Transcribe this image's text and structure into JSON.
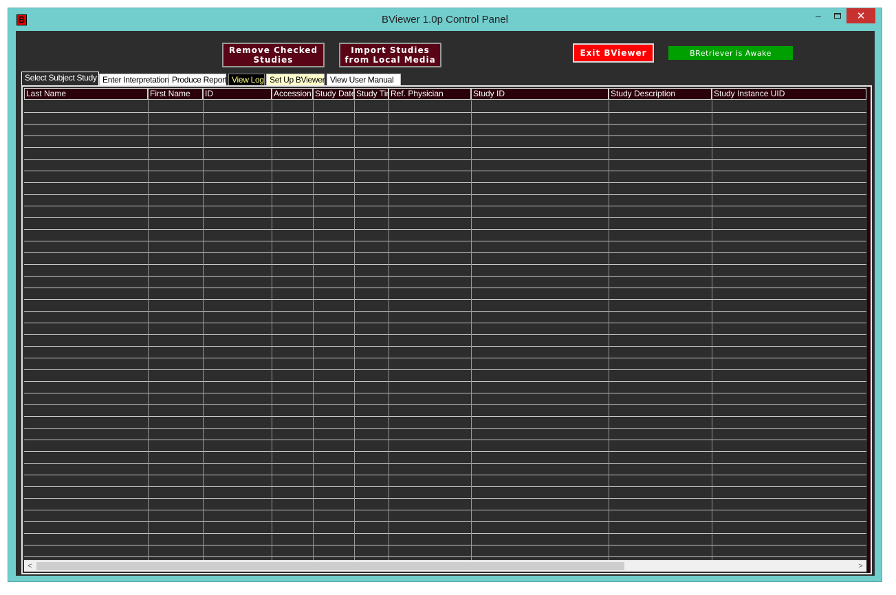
{
  "window": {
    "title": "BViewer 1.0p Control Panel",
    "app_icon_letter": "B",
    "minimize_glyph": "–",
    "close_glyph": "✕"
  },
  "toolbar": {
    "remove_label_line1": "Remove Checked",
    "remove_label_line2": "Studies",
    "import_label_line1": "Import Studies",
    "import_label_line2": "from Local Media",
    "exit_label": "Exit BViewer",
    "status_text": "BRetriever is Awake"
  },
  "tabs": [
    {
      "label": "Select Subject Study"
    },
    {
      "label": "Enter Interpretation"
    },
    {
      "label": "Produce Report"
    },
    {
      "label": "View Log"
    },
    {
      "label": "Set Up BViewer"
    },
    {
      "label": "View User Manual"
    }
  ],
  "table": {
    "columns": [
      {
        "label": "Last Name"
      },
      {
        "label": "First Name"
      },
      {
        "label": "ID"
      },
      {
        "label": "Accession"
      },
      {
        "label": "Study Date"
      },
      {
        "label": "Study Time"
      },
      {
        "label": "Ref. Physician"
      },
      {
        "label": "Study ID"
      },
      {
        "label": "Study Description"
      },
      {
        "label": "Study Instance UID"
      }
    ]
  },
  "scrollbar": {
    "left_glyph": "<",
    "right_glyph": ">"
  },
  "colors": {
    "window_border": "#72cdcd",
    "panel_bg": "#2d2d2d",
    "header_bg": "#2a000a",
    "maroon_button": "#5a0517",
    "exit_red": "#ff0000",
    "status_green": "#00a000",
    "close_red": "#c7312f"
  },
  "icons": [
    "app-logo-icon",
    "minimize-icon",
    "maximize-icon",
    "close-icon",
    "scroll-left-icon",
    "scroll-right-icon"
  ]
}
